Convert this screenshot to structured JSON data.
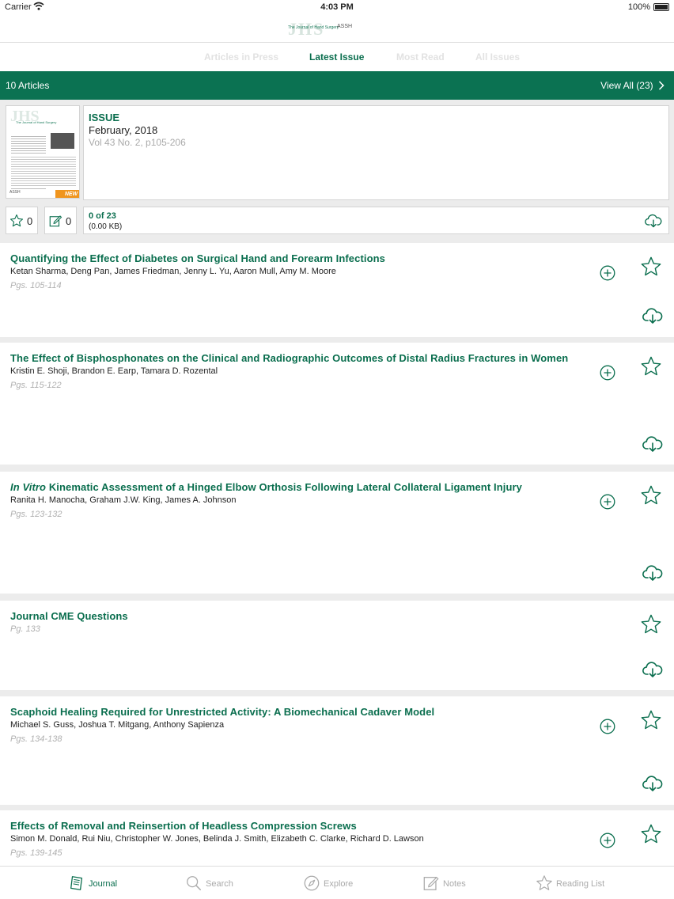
{
  "status_bar": {
    "carrier": "Carrier",
    "time": "4:03 PM",
    "battery": "100%"
  },
  "logo": {
    "mark": "JHS",
    "journal": "The Journal of Hand Surgery",
    "society": "ASSH"
  },
  "tabs": [
    {
      "label": "Articles in Press",
      "active": false
    },
    {
      "label": "Latest Issue",
      "active": true
    },
    {
      "label": "Most Read",
      "active": false
    },
    {
      "label": "All Issues",
      "active": false
    }
  ],
  "banner": {
    "count": "10 Articles",
    "view_all": "View All (23)"
  },
  "issue": {
    "cover": {
      "mark": "JHS",
      "title": "The Journal of Hand Surgery",
      "badge": "NEW",
      "society": "ASSH"
    },
    "label": "ISSUE",
    "date": "February, 2018",
    "volume": "Vol 43 No. 2, p105-206",
    "stars": "0",
    "notes": "0",
    "downloads": "0 of 23",
    "size": "(0.00 KB)"
  },
  "articles": [
    {
      "title": "Quantifying the Effect of Diabetes on Surgical Hand and Forearm Infections",
      "authors": "Ketan Sharma, Deng Pan, James Friedman, Jenny L. Yu, Aaron Mull, Amy M. Moore",
      "pages": "Pgs. 105-114"
    },
    {
      "title": "The Effect of Bisphosphonates on the Clinical and Radiographic Outcomes of Distal Radius Fractures in Women",
      "authors": "Kristin E. Shoji, Brandon E. Earp, Tamara D. Rozental",
      "pages": "Pgs. 115-122"
    },
    {
      "title_italic": "In Vitro",
      "title": " Kinematic Assessment of a Hinged Elbow Orthosis Following Lateral Collateral Ligament Injury",
      "authors": "Ranita H. Manocha, Graham J.W. King, James A. Johnson",
      "pages": "Pgs. 123-132"
    },
    {
      "title": "Journal CME Questions",
      "pages": "Pg. 133"
    },
    {
      "title": "Scaphoid Healing Required for Unrestricted Activity: A Biomechanical Cadaver Model",
      "authors": "Michael S. Guss, Joshua T. Mitgang, Anthony Sapienza",
      "pages": "Pgs. 134-138"
    },
    {
      "title": "Effects of Removal and Reinsertion of Headless Compression Screws",
      "authors": "Simon M. Donald, Rui Niu, Christopher W. Jones, Belinda J. Smith, Elizabeth C. Clarke, Richard D. Lawson",
      "pages": "Pgs. 139-145"
    }
  ],
  "tabbar": [
    {
      "label": "Journal",
      "icon": "journal-icon",
      "active": true
    },
    {
      "label": "Search",
      "icon": "search-icon",
      "active": false
    },
    {
      "label": "Explore",
      "icon": "compass-icon",
      "active": false
    },
    {
      "label": "Notes",
      "icon": "notes-icon",
      "active": false
    },
    {
      "label": "Reading List",
      "icon": "star-icon",
      "active": false
    }
  ],
  "colors": {
    "accent": "#0a6e4e",
    "banner": "#0b7252",
    "badge": "#f0951e",
    "inactive": "#aaaaaa"
  }
}
